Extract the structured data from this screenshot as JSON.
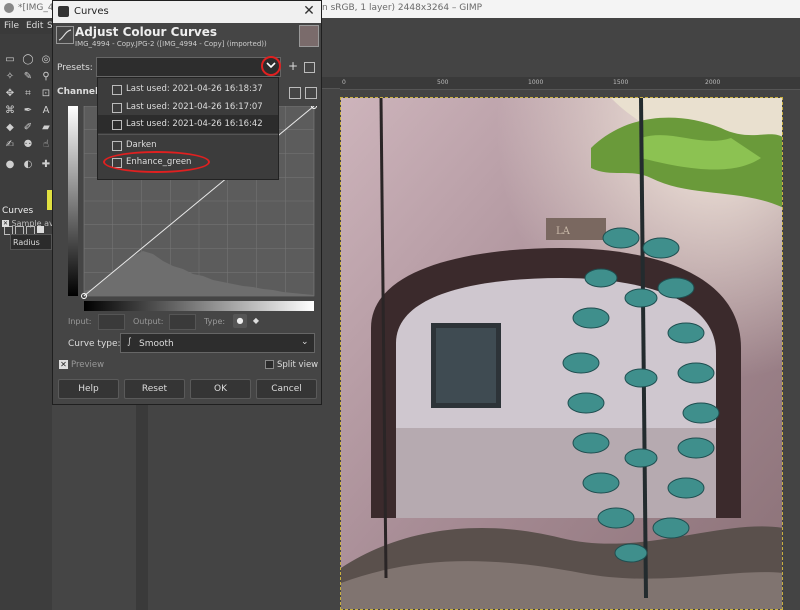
{
  "main_window": {
    "title_left": "*[IMG_499",
    "title_right": "n sRGB, 1 layer) 2448x3264 – GIMP"
  },
  "menubar": {
    "file": "File",
    "edit": "Edit",
    "select": "S"
  },
  "tool_options": {
    "title": "Curves",
    "sample_average": "Sample av",
    "radius": "Radius"
  },
  "rulers": {
    "top": [
      "0",
      "500",
      "1000",
      "1500",
      "2000"
    ],
    "left": [
      "500",
      "1000",
      "1500"
    ]
  },
  "dialog": {
    "title": "Curves",
    "heading": "Adjust Colour Curves",
    "subheading": "IMG_4994 - Copy.JPG-2 ([IMG_4994 - Copy] (imported))",
    "presets_label": "Presets:",
    "presets_add": "+",
    "channel_label": "Channel",
    "preset_items": [
      "Last used: 2021-04-26 16:18:37",
      "Last used: 2021-04-26 16:17:07",
      "Last used: 2021-04-26 16:16:42",
      "Darken",
      "Enhance_green"
    ],
    "input_label": "Input:",
    "output_label": "Output:",
    "type_label": "Type:",
    "curve_type_label": "Curve type:",
    "curve_type_value": "Smooth",
    "preview_label": "Preview",
    "split_view_label": "Split view",
    "buttons": {
      "help": "Help",
      "reset": "Reset",
      "ok": "OK",
      "cancel": "Cancel"
    }
  },
  "colors": {
    "highlight": "#e02020",
    "dialog_bg": "#454545"
  }
}
